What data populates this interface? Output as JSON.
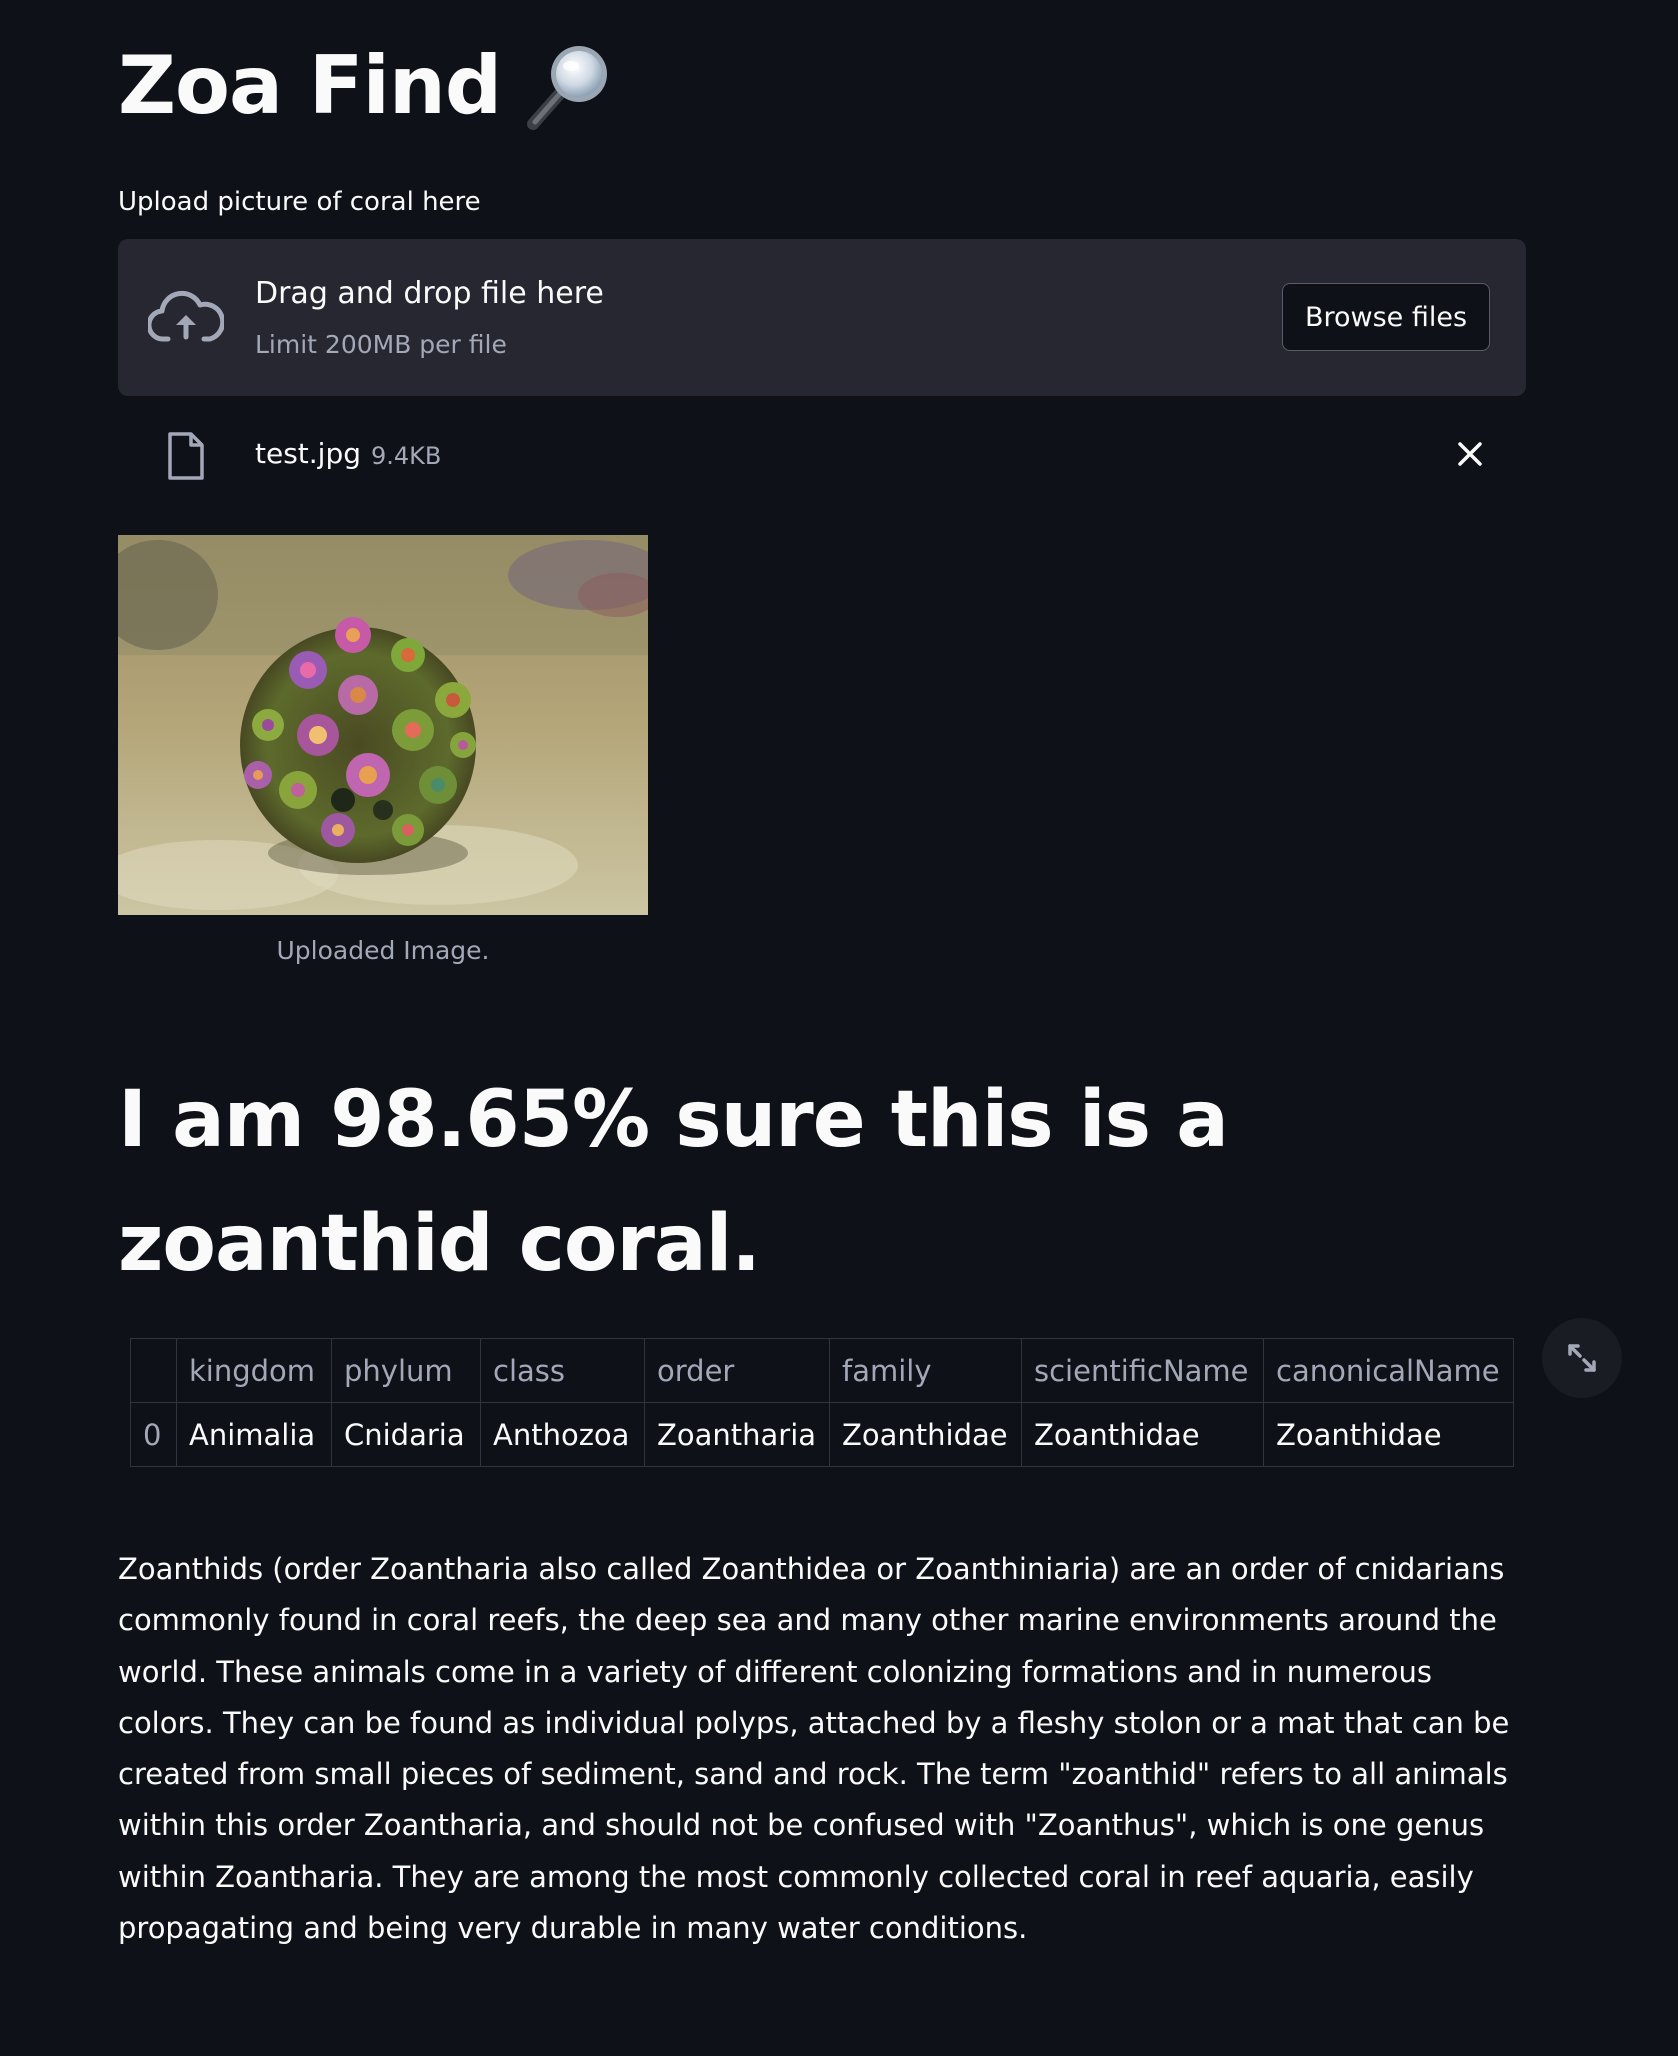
{
  "header": {
    "title": "Zoa Find",
    "title_icon": "magnifying-glass-icon"
  },
  "uploader": {
    "label": "Upload picture of coral here",
    "drop_text": "Drag and drop file here",
    "limit_text": "Limit 200MB per file",
    "browse_label": "Browse files",
    "upload_icon": "cloud-upload-icon"
  },
  "uploaded_file": {
    "name": "test.jpg",
    "size": "9.4KB",
    "file_icon": "file-icon",
    "remove_icon": "close-icon"
  },
  "image": {
    "caption": "Uploaded Image."
  },
  "result": {
    "heading": "I am 98.65% sure this is a zoanthid coral."
  },
  "taxonomy_table": {
    "columns": [
      "",
      "kingdom",
      "phylum",
      "class",
      "order",
      "family",
      "scientificName",
      "canonicalName"
    ],
    "rows": [
      [
        "0",
        "Animalia",
        "Cnidaria",
        "Anthozoa",
        "Zoantharia",
        "Zoanthidae",
        "Zoanthidae",
        "Zoanthidae"
      ]
    ],
    "expand_icon": "fullscreen-expand-icon"
  },
  "description": "Zoanthids (order Zoantharia also called Zoanthidea or Zoanthiniaria) are an order of cnidarians commonly found in coral reefs, the deep sea and many other marine environments around the world. These animals come in a variety of different colonizing formations and in numerous colors. They can be found as individual polyps, attached by a fleshy stolon or a mat that can be created from small pieces of sediment, sand and rock. The term \"zoanthid\" refers to all animals within this order Zoantharia, and should not be confused with \"Zoanthus\", which is one genus within Zoantharia. They are among the most commonly collected coral in reef aquaria, easily propagating and being very durable in many water conditions.",
  "colors": {
    "background": "#0e1117",
    "panel": "#262730",
    "text": "#fafafa",
    "muted_text": "#a3a8b8",
    "table_border": "#31333f"
  }
}
